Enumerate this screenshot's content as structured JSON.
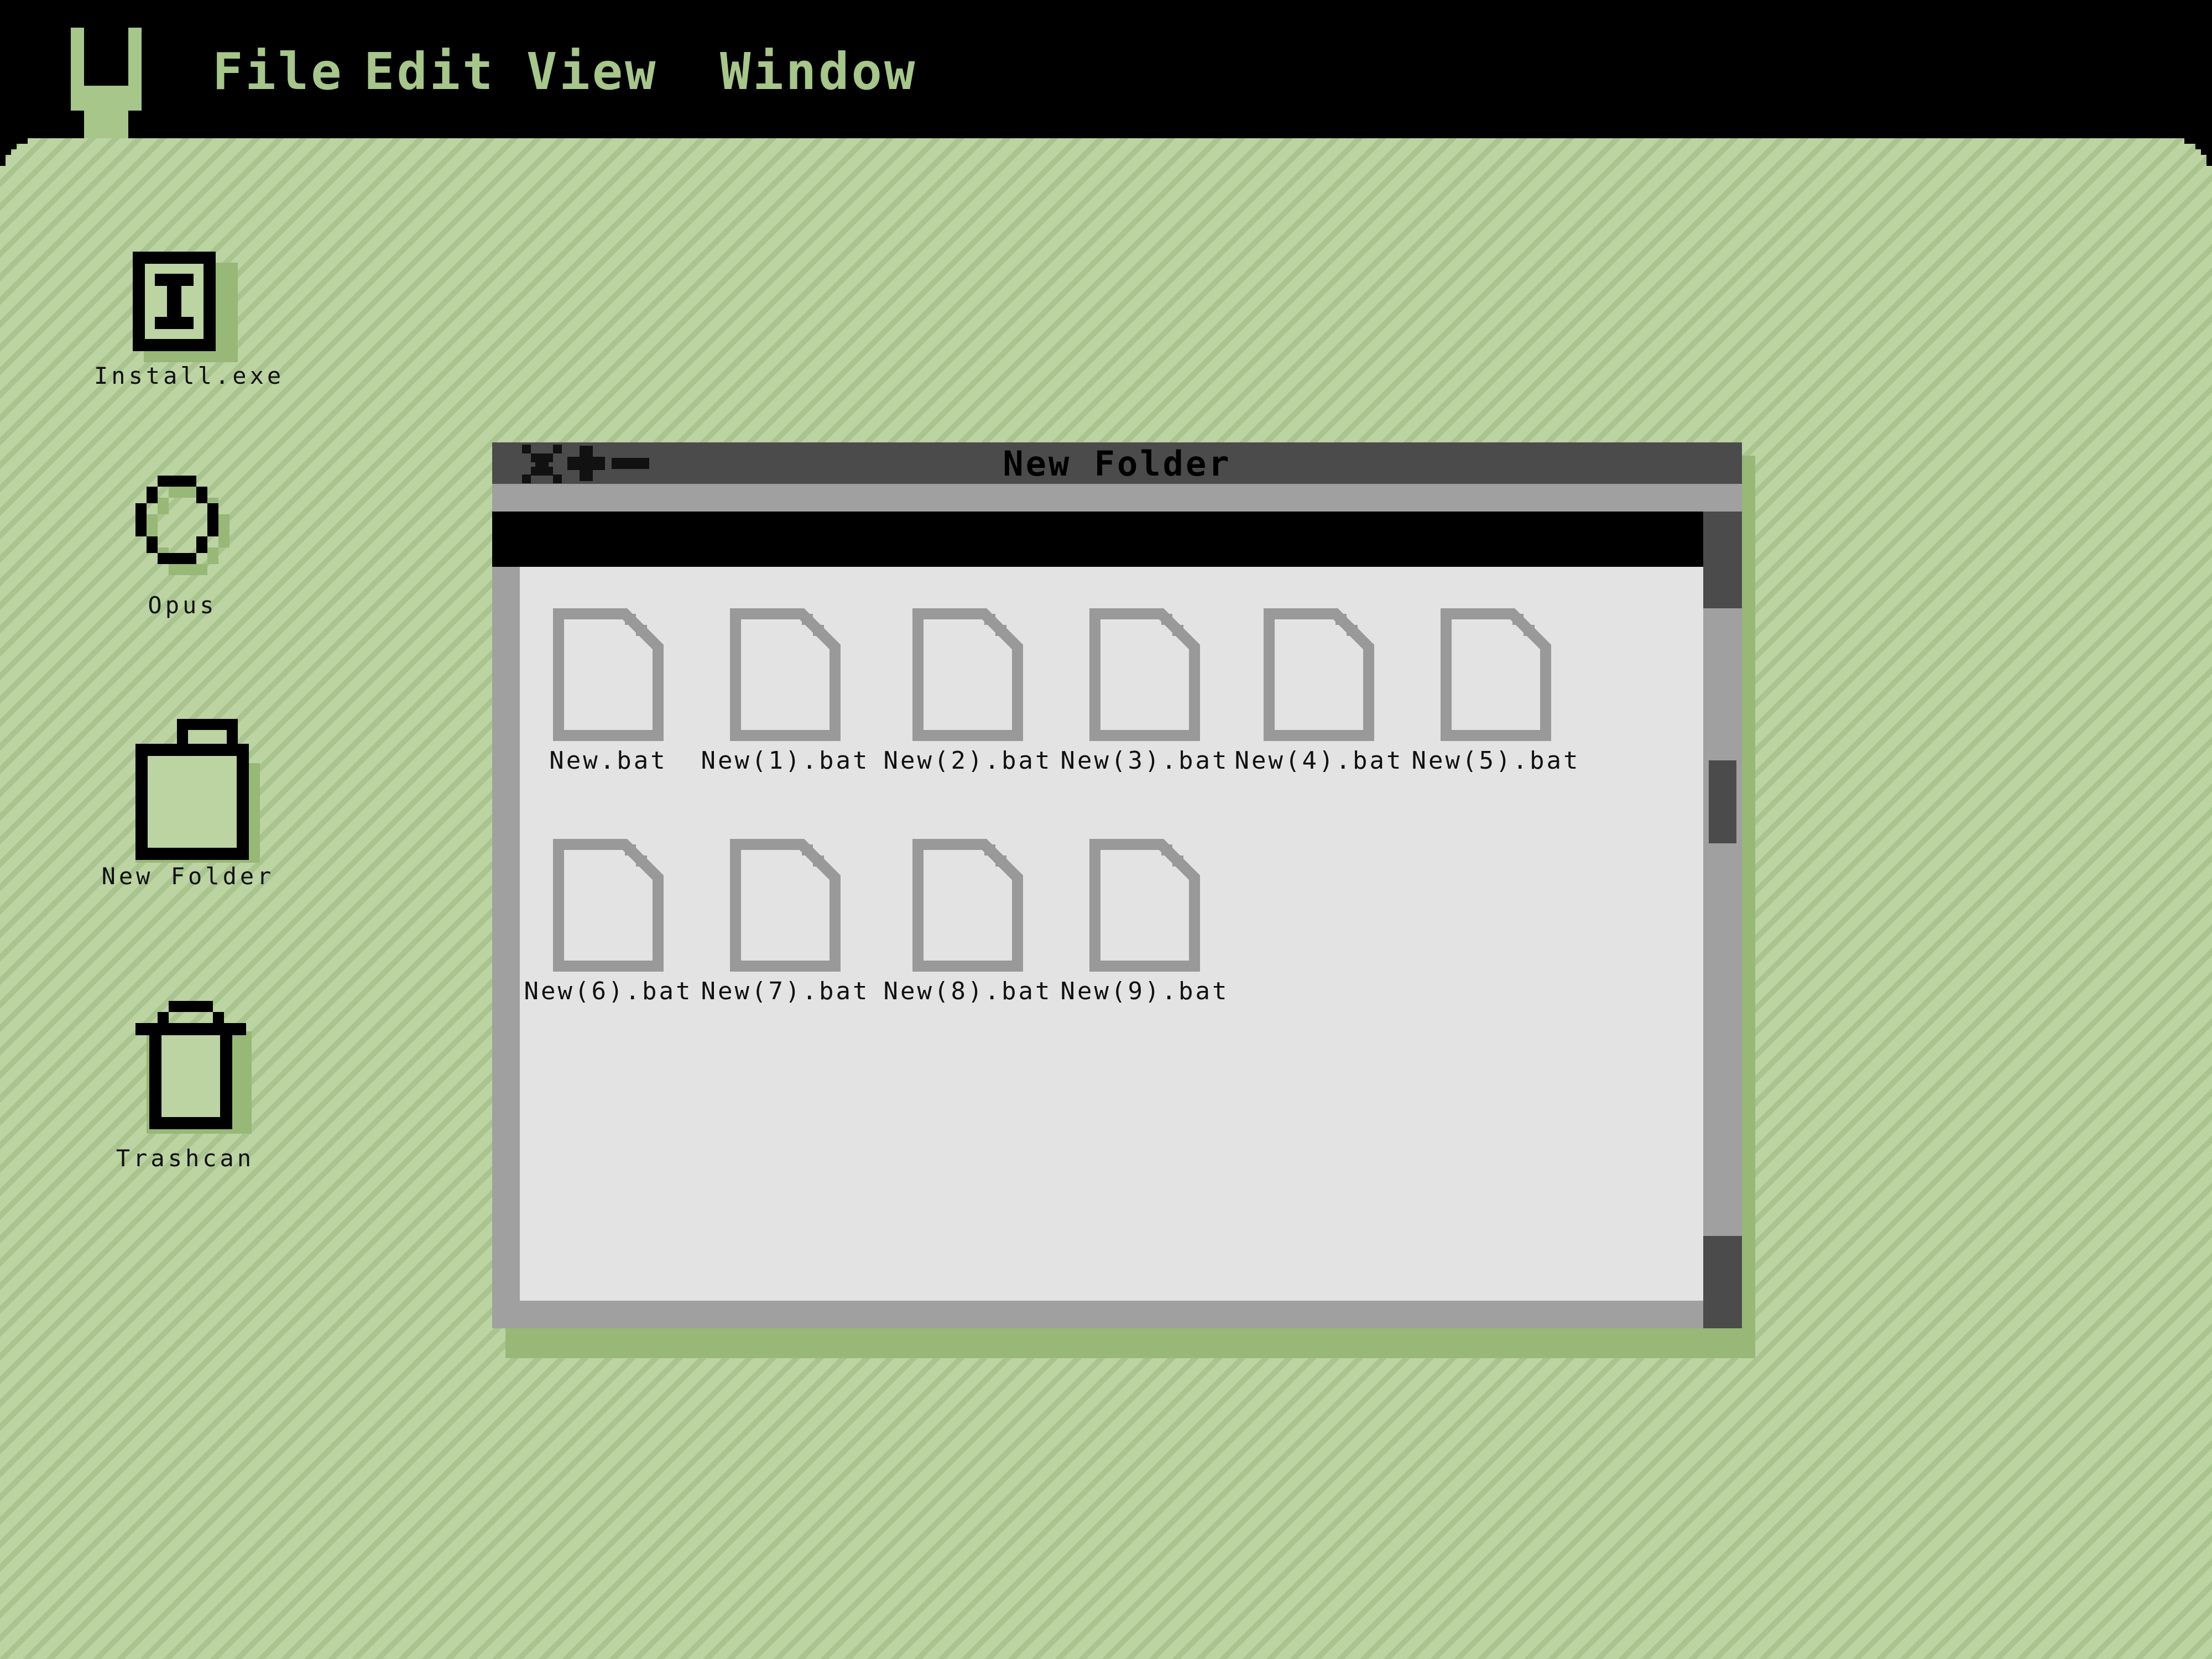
{
  "menubar": {
    "items": [
      "File",
      "Edit",
      "View",
      "Window"
    ]
  },
  "desktop": {
    "icons": [
      {
        "label": "Install.exe",
        "icon": "installer-icon"
      },
      {
        "label": "Opus",
        "icon": "opus-icon"
      },
      {
        "label": "New Folder",
        "icon": "folder-icon"
      },
      {
        "label": "Trashcan",
        "icon": "trash-icon"
      }
    ]
  },
  "window": {
    "title": "New Folder",
    "address": "",
    "files": [
      "New.bat",
      "New(1).bat",
      "New(2).bat",
      "New(3).bat",
      "New(4).bat",
      "New(5).bat",
      "New(6).bat",
      "New(7).bat",
      "New(8).bat",
      "New(9).bat"
    ]
  },
  "colors": {
    "desktop_bg": "#bcd3a2",
    "stripe": "#a9c48e",
    "accent": "#a6c68a",
    "shadow": "#97b876",
    "window_dark": "#4b4b4b",
    "window_mid": "#a0a0a0",
    "window_content": "#e3e3e3"
  }
}
